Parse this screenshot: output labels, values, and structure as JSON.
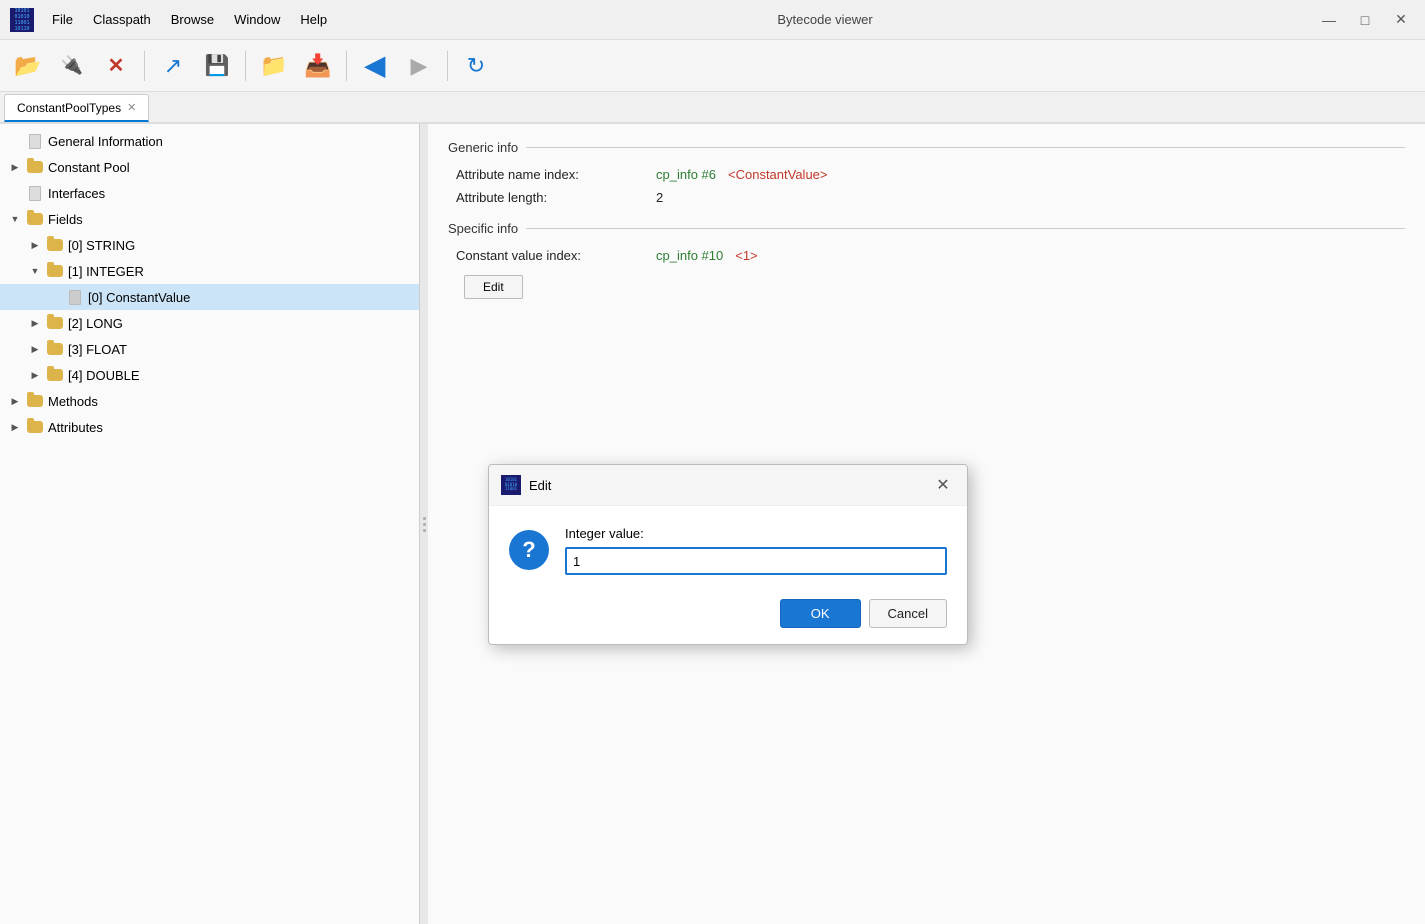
{
  "titleBar": {
    "logoLines": [
      "10101",
      "01010",
      "11001",
      "10110"
    ],
    "menus": [
      "File",
      "Classpath",
      "Browse",
      "Window",
      "Help"
    ],
    "title": "Bytecode viewer",
    "controls": [
      "—",
      "□",
      "✕"
    ]
  },
  "toolbar": {
    "buttons": [
      {
        "name": "open-button",
        "icon": "📂",
        "class": "tb-open",
        "label": "Open"
      },
      {
        "name": "plugin-button",
        "icon": "🔌",
        "class": "tb-plug",
        "label": "Plugin"
      },
      {
        "name": "close-button",
        "icon": "✕",
        "class": "tb-close",
        "label": "Close"
      },
      {
        "name": "export-button",
        "icon": "↗",
        "class": "tb-export",
        "label": "Export"
      },
      {
        "name": "save-button",
        "icon": "💾",
        "class": "tb-save",
        "label": "Save"
      },
      {
        "name": "folder-open-button",
        "icon": "📁",
        "class": "tb-folder",
        "label": "Folder Open"
      },
      {
        "name": "save-as-button",
        "icon": "📥",
        "class": "tb-folder",
        "label": "Save As"
      },
      {
        "name": "back-button",
        "icon": "◀",
        "class": "tb-nav",
        "label": "Back"
      },
      {
        "name": "forward-button",
        "icon": "▶",
        "class": "tb-nav",
        "label": "Forward"
      },
      {
        "name": "refresh-button",
        "icon": "↻",
        "class": "tb-refresh",
        "label": "Refresh"
      }
    ]
  },
  "tabs": [
    {
      "label": "ConstantPoolTypes",
      "name": "constantpooltypes-tab"
    }
  ],
  "tree": {
    "items": [
      {
        "id": "general-info",
        "label": "General Information",
        "indent": "indent-1",
        "type": "file",
        "arrow": "",
        "selected": false
      },
      {
        "id": "constant-pool",
        "label": "Constant Pool",
        "indent": "indent-1",
        "type": "folder",
        "arrow": "▶",
        "selected": false
      },
      {
        "id": "interfaces",
        "label": "Interfaces",
        "indent": "indent-1",
        "type": "file",
        "arrow": "",
        "selected": false
      },
      {
        "id": "fields",
        "label": "Fields",
        "indent": "indent-1",
        "type": "folder",
        "arrow": "▼",
        "selected": false,
        "expanded": true
      },
      {
        "id": "fields-0-string",
        "label": "[0] STRING",
        "indent": "indent-2",
        "type": "folder",
        "arrow": "▶",
        "selected": false
      },
      {
        "id": "fields-1-integer",
        "label": "[1] INTEGER",
        "indent": "indent-2",
        "type": "folder",
        "arrow": "▼",
        "selected": false,
        "expanded": true
      },
      {
        "id": "fields-1-0-constantvalue",
        "label": "[0] ConstantValue",
        "indent": "indent-3",
        "type": "file",
        "arrow": "",
        "selected": true
      },
      {
        "id": "fields-2-long",
        "label": "[2] LONG",
        "indent": "indent-2",
        "type": "folder",
        "arrow": "▶",
        "selected": false
      },
      {
        "id": "fields-3-float",
        "label": "[3] FLOAT",
        "indent": "indent-2",
        "type": "folder",
        "arrow": "▶",
        "selected": false
      },
      {
        "id": "fields-4-double",
        "label": "[4] DOUBLE",
        "indent": "indent-2",
        "type": "folder",
        "arrow": "▶",
        "selected": false
      },
      {
        "id": "methods",
        "label": "Methods",
        "indent": "indent-1",
        "type": "folder",
        "arrow": "▶",
        "selected": false
      },
      {
        "id": "attributes",
        "label": "Attributes",
        "indent": "indent-1",
        "type": "folder",
        "arrow": "▶",
        "selected": false
      }
    ]
  },
  "rightPanel": {
    "genericInfo": {
      "sectionLabel": "Generic info",
      "rows": [
        {
          "label": "Attribute name index:",
          "link": "cp_info #6",
          "value": "<ConstantValue>"
        },
        {
          "label": "Attribute length:",
          "plain": "2"
        }
      ]
    },
    "specificInfo": {
      "sectionLabel": "Specific info",
      "rows": [
        {
          "label": "Constant value index:",
          "link": "cp_info #10",
          "value": "<1>"
        }
      ]
    },
    "editButton": "Edit"
  },
  "dialog": {
    "title": "Edit",
    "fieldLabel": "Integer value:",
    "inputValue": "1",
    "okLabel": "OK",
    "cancelLabel": "Cancel"
  }
}
